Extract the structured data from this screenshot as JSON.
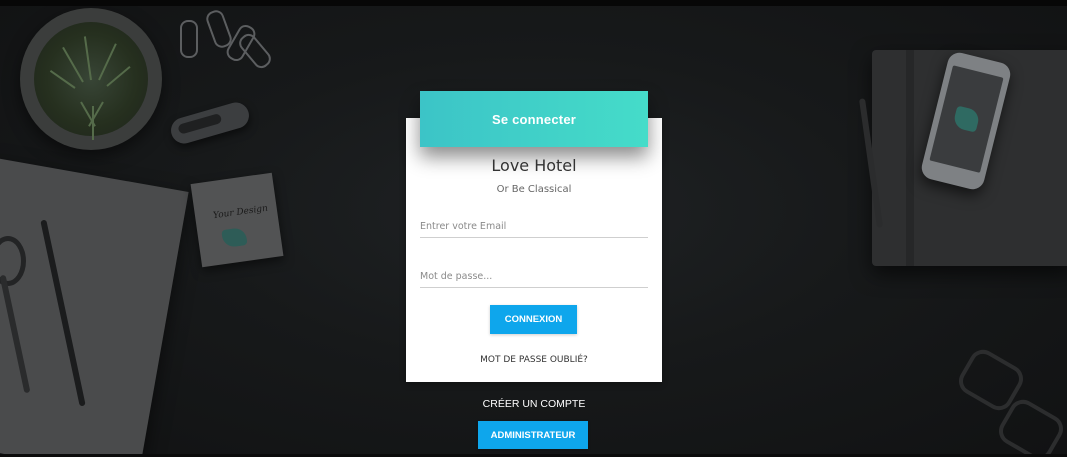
{
  "login_card": {
    "header_label": "Se connecter",
    "title": "Love Hotel",
    "subtitle": "Or Be Classical",
    "email_placeholder": "Entrer votre Email",
    "password_placeholder": "Mot de passe...",
    "login_button_label": "CONNEXION",
    "forgot_password_label": "MOT DE PASSE OUBLIÉ?"
  },
  "below_card": {
    "create_account_label": "CRÉER UN COMPTE",
    "admin_button_label": "ADMINISTRATEUR"
  },
  "background": {
    "sticky_note_text": "Your Design",
    "icons": [
      "plant-icon",
      "paperclip-icon",
      "stapler-icon",
      "notebook-icon",
      "scissors-icon",
      "pen-icon",
      "phone-icon",
      "glasses-icon"
    ]
  },
  "colors": {
    "header_gradient_start": "#3cc4c7",
    "header_gradient_end": "#45dcc9",
    "button_blue": "#0ea6ec",
    "background_dark": "#17191a",
    "card_background": "#ffffff"
  }
}
